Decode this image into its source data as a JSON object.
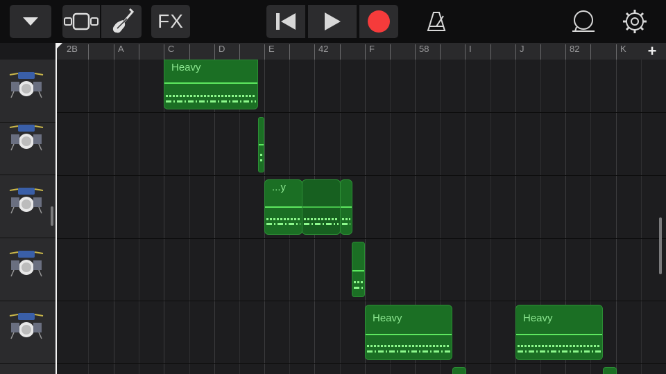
{
  "toolbar": {
    "fx_label": "FX",
    "icons": [
      "chevron-down-icon",
      "track-view-icon",
      "instrument-guitar-icon",
      "fx",
      "go-to-beginning-icon",
      "play-icon",
      "record-icon",
      "metronome-icon",
      "loop-icon",
      "settings-gear-icon"
    ],
    "record_color": "#f53b3b"
  },
  "ruler": {
    "markers": [
      "2B",
      "A",
      "C",
      "D",
      "E",
      "42",
      "F",
      "58",
      "I",
      "J",
      "82",
      "K"
    ],
    "add_label": "+"
  },
  "tracks": [
    {
      "instrument": "drum-kit-icon"
    },
    {
      "instrument": "drum-kit-icon"
    },
    {
      "instrument": "drum-kit-icon"
    },
    {
      "instrument": "drum-kit-icon"
    },
    {
      "instrument": "drum-kit-icon"
    }
  ],
  "regions": [
    {
      "label": "Heavy"
    },
    {
      "label": ""
    },
    {
      "label": "...y"
    },
    {
      "label": ""
    },
    {
      "label": ""
    },
    {
      "label": ""
    },
    {
      "label": "Heavy"
    },
    {
      "label": "Heavy"
    }
  ],
  "colors": {
    "region_fill": "#1b6f24",
    "region_line": "#5ee860",
    "background": "#1d1d1f"
  }
}
